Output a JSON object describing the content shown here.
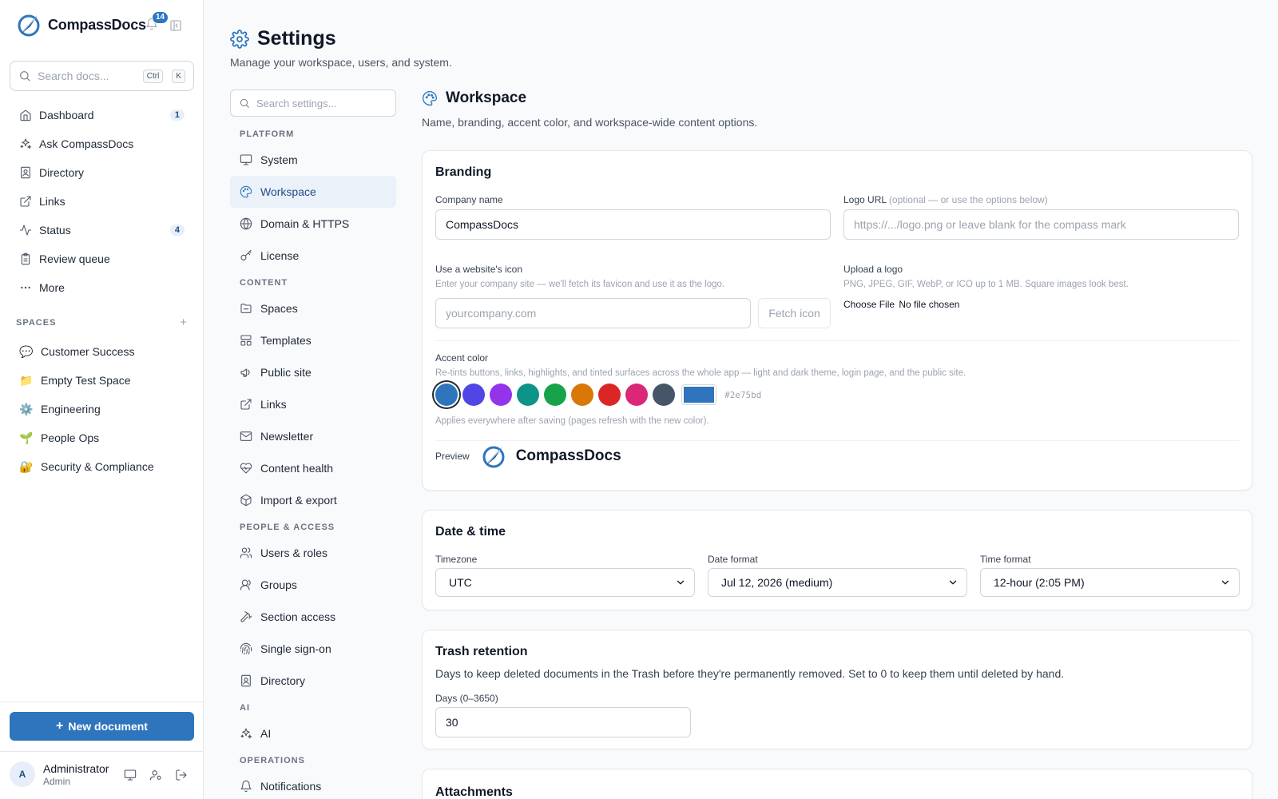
{
  "app": {
    "name": "CompassDocs",
    "notification_count": "14"
  },
  "sidebar": {
    "search_placeholder": "Search docs...",
    "shortcut_ctrl": "Ctrl",
    "shortcut_key": "K",
    "nav": [
      {
        "label": "Dashboard",
        "icon": "home-icon",
        "count": "1"
      },
      {
        "label": "Ask CompassDocs",
        "icon": "sparkles-icon",
        "count": ""
      },
      {
        "label": "Directory",
        "icon": "contact-book-icon",
        "count": ""
      },
      {
        "label": "Links",
        "icon": "external-link-icon",
        "count": ""
      },
      {
        "label": "Status",
        "icon": "activity-icon",
        "count": "4"
      },
      {
        "label": "Review queue",
        "icon": "clipboard-icon",
        "count": ""
      },
      {
        "label": "More",
        "icon": "more-dots-icon",
        "count": ""
      }
    ],
    "spaces_header": "SPACES",
    "spaces_add": "+",
    "spaces": [
      {
        "emoji": "💬",
        "label": "Customer Success"
      },
      {
        "emoji": "📁",
        "label": "Empty Test Space"
      },
      {
        "emoji": "⚙️",
        "label": "Engineering"
      },
      {
        "emoji": "🌱",
        "label": "People Ops"
      },
      {
        "emoji": "🔐",
        "label": "Security & Compliance"
      }
    ],
    "new_document": "New document",
    "new_document_plus": "+",
    "user": {
      "initial": "A",
      "name": "Administrator",
      "role": "Admin"
    }
  },
  "page": {
    "title": "Settings",
    "subtitle": "Manage your workspace, users, and system."
  },
  "settings_nav": {
    "search_placeholder": "Search settings...",
    "groups": [
      {
        "label": "PLATFORM",
        "items": [
          {
            "label": "System",
            "icon": "monitor-icon"
          },
          {
            "label": "Workspace",
            "icon": "palette-icon",
            "active": true
          },
          {
            "label": "Domain & HTTPS",
            "icon": "globe-icon"
          },
          {
            "label": "License",
            "icon": "key-icon"
          }
        ]
      },
      {
        "label": "CONTENT",
        "items": [
          {
            "label": "Spaces",
            "icon": "folder-icon"
          },
          {
            "label": "Templates",
            "icon": "template-icon"
          },
          {
            "label": "Public site",
            "icon": "megaphone-icon"
          },
          {
            "label": "Links",
            "icon": "external-link-icon"
          },
          {
            "label": "Newsletter",
            "icon": "mail-icon"
          },
          {
            "label": "Content health",
            "icon": "heart-pulse-icon"
          },
          {
            "label": "Import & export",
            "icon": "package-icon"
          }
        ]
      },
      {
        "label": "PEOPLE & ACCESS",
        "items": [
          {
            "label": "Users & roles",
            "icon": "users-icon"
          },
          {
            "label": "Groups",
            "icon": "group-icon"
          },
          {
            "label": "Section access",
            "icon": "hammer-icon"
          },
          {
            "label": "Single sign-on",
            "icon": "fingerprint-icon"
          },
          {
            "label": "Directory",
            "icon": "contact-book-icon"
          }
        ]
      },
      {
        "label": "AI",
        "items": [
          {
            "label": "AI",
            "icon": "sparkles-icon"
          }
        ]
      },
      {
        "label": "OPERATIONS",
        "items": [
          {
            "label": "Notifications",
            "icon": "bell-icon"
          }
        ]
      }
    ]
  },
  "workspace": {
    "title": "Workspace",
    "subtitle": "Name, branding, accent color, and workspace-wide content options.",
    "branding": {
      "title": "Branding",
      "company_name_label": "Company name",
      "company_name_value": "CompassDocs",
      "logo_url_label": "Logo URL",
      "logo_url_hint": "(optional — or use the options below)",
      "logo_url_placeholder": "https://.../logo.png or leave blank for the compass mark",
      "website_icon_label": "Use a website's icon",
      "website_icon_hint": "Enter your company site — we'll fetch its favicon and use it as the logo.",
      "website_placeholder": "yourcompany.com",
      "fetch_icon": "Fetch icon",
      "upload_label": "Upload a logo",
      "upload_hint": "PNG, JPEG, GIF, WebP, or ICO up to 1 MB. Square images look best.",
      "choose_file": "Choose File",
      "no_file": "No file chosen",
      "accent_label": "Accent color",
      "accent_hint": "Re-tints buttons, links, highlights, and tinted surfaces across the whole app — light and dark theme, login page, and the public site.",
      "swatches": [
        "#2e75bd",
        "#4f46e5",
        "#9333ea",
        "#0d9488",
        "#16a34a",
        "#d97706",
        "#dc2626",
        "#db2777",
        "#475569"
      ],
      "custom_color": "#2e75bd",
      "hex_value": "#2e75bd",
      "accent_footer": "Applies everywhere after saving (pages refresh with the new color).",
      "preview_label": "Preview",
      "preview_name": "CompassDocs"
    },
    "datetime": {
      "title": "Date & time",
      "timezone_label": "Timezone",
      "timezone_value": "UTC",
      "date_format_label": "Date format",
      "date_format_value": "Jul 12, 2026 (medium)",
      "time_format_label": "Time format",
      "time_format_value": "12-hour (2:05 PM)"
    },
    "trash": {
      "title": "Trash retention",
      "subtitle": "Days to keep deleted documents in the Trash before they're permanently removed. Set to 0 to keep them until deleted by hand.",
      "days_label": "Days (0–3650)",
      "days_value": "30"
    },
    "attachments": {
      "title": "Attachments"
    }
  },
  "colors": {
    "accent": "#2e75bd",
    "active_bg": "#eaf1f9"
  }
}
